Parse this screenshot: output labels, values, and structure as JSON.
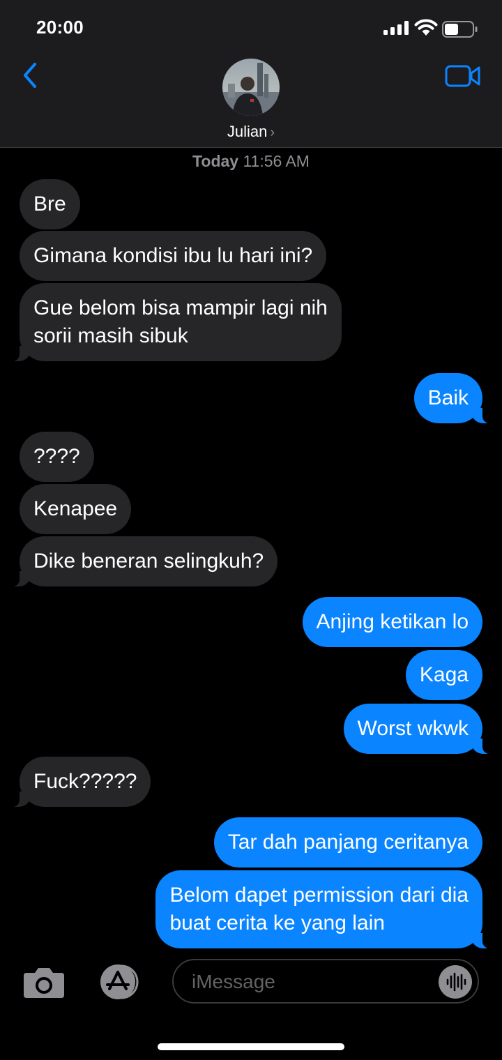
{
  "status_bar": {
    "time": "20:00",
    "signal_icon": "cellular-signal-icon",
    "wifi_icon": "wifi-icon",
    "battery_icon": "battery-icon",
    "battery_level": 0.5
  },
  "header": {
    "back_icon": "chevron-left-icon",
    "video_icon": "video-camera-icon",
    "contact_name": "Julian",
    "contact_chevron": "›",
    "accent_color": "#0a84ff"
  },
  "conversation": {
    "timestamp_day": "Today",
    "timestamp_time": "11:56 AM",
    "messages": [
      {
        "from": "them",
        "lines": [
          "Bre"
        ]
      },
      {
        "from": "them",
        "lines": [
          "Gimana kondisi ibu lu hari ini?"
        ]
      },
      {
        "from": "them",
        "lines": [
          "Gue belom bisa mampir lagi nih",
          "sorii masih sibuk"
        ]
      },
      {
        "from": "me",
        "lines": [
          "Baik"
        ]
      },
      {
        "from": "them",
        "lines": [
          "????"
        ]
      },
      {
        "from": "them",
        "lines": [
          "Kenapee"
        ]
      },
      {
        "from": "them",
        "lines": [
          "Dike beneran selingkuh?"
        ]
      },
      {
        "from": "me",
        "lines": [
          "Anjing ketikan lo"
        ]
      },
      {
        "from": "me",
        "lines": [
          "Kaga"
        ]
      },
      {
        "from": "me",
        "lines": [
          "Worst wkwk"
        ]
      },
      {
        "from": "them",
        "lines": [
          "Fuck?????"
        ]
      },
      {
        "from": "me",
        "lines": [
          "Tar dah panjang ceritanya"
        ]
      },
      {
        "from": "me",
        "lines": [
          "Belom dapet permission dari dia",
          "buat cerita ke yang lain"
        ]
      }
    ]
  },
  "input_bar": {
    "camera_icon": "camera-icon",
    "apps_icon": "app-store-icon",
    "placeholder": "iMessage",
    "audio_icon": "audio-waveform-icon"
  }
}
